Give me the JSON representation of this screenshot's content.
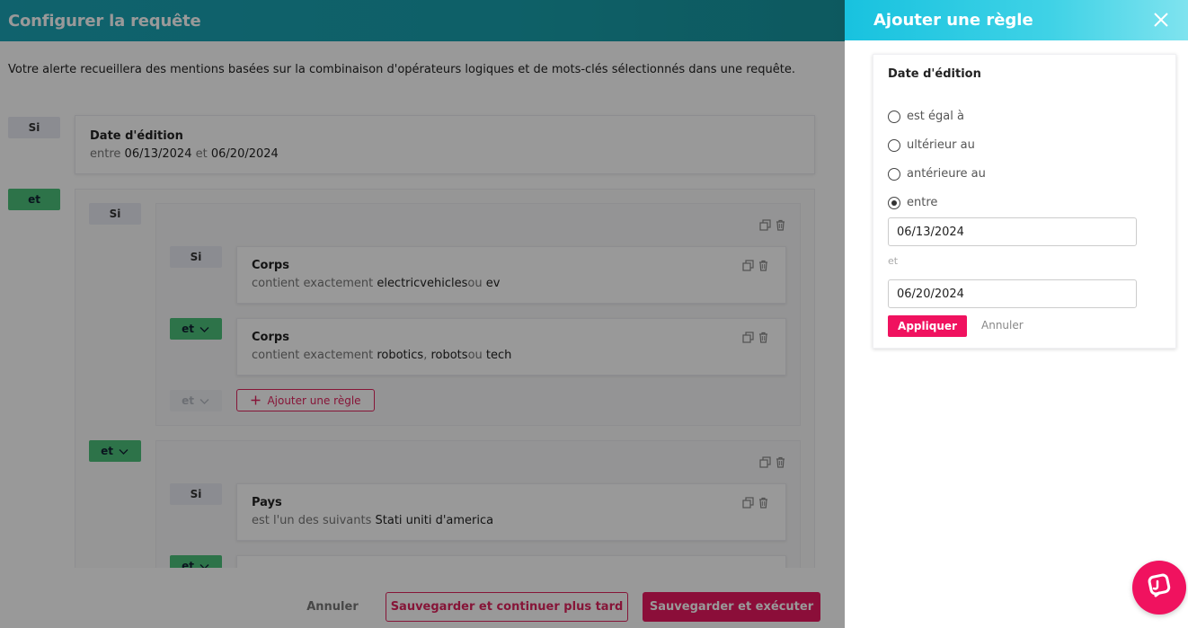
{
  "page": {
    "title": "Configurer la requête",
    "intro": "Votre alerte recueillera des mentions basées sur la combinaison d'opérateurs logiques et de mots-clés sélectionnés dans une requête."
  },
  "rules": {
    "si_label": "Si",
    "et_label": "et",
    "date_rule": {
      "title": "Date d'édition",
      "prefix": "entre",
      "start": "06/13/2024",
      "joiner": "et",
      "end": "06/20/2024"
    },
    "group1": {
      "corps1": {
        "title": "Corps",
        "prefix": "contient exactement",
        "value1": "electricvehicles",
        "joiner": "ou",
        "value2": "ev"
      },
      "corps2": {
        "title": "Corps",
        "prefix": "contient exactement",
        "value1": "robotics",
        "comma": ",",
        "value2": "robots",
        "joiner": "ou",
        "value3": "tech"
      },
      "add_rule_label": "Ajouter une règle"
    },
    "group2": {
      "pays": {
        "title": "Pays",
        "prefix": "est l'un des suivants",
        "value": "Stati uniti d'america"
      }
    }
  },
  "footer": {
    "cancel": "Annuler",
    "save_later": "Sauvegarder et continuer plus tard",
    "save_run": "Sauvegarder et exécuter"
  },
  "panel": {
    "title": "Ajouter une règle",
    "rule_title": "Date d'édition",
    "options": [
      "est égal à",
      "ultérieur au",
      "antérieure au",
      "entre"
    ],
    "selected_option": "entre",
    "start_date": "06/13/2024",
    "separator": "et",
    "end_date": "06/20/2024",
    "apply": "Appliquer",
    "cancel": "Annuler"
  },
  "colors": {
    "brand_pink": "#f0125f",
    "teal_header": "#18a1ad",
    "panel_header": "#18c2df",
    "tag_green": "#4bc07a"
  }
}
